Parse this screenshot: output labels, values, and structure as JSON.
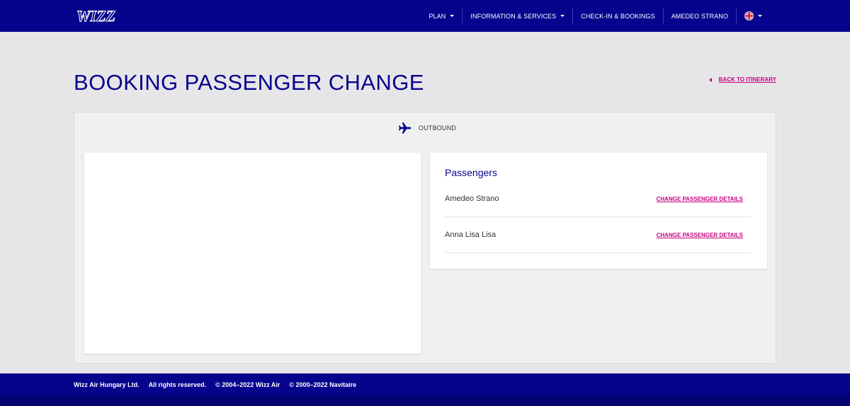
{
  "header": {
    "logo_text": "WIZZ",
    "nav": [
      {
        "label": "PLAN",
        "dropdown": true
      },
      {
        "label": "INFORMATION & SERVICES",
        "dropdown": true
      },
      {
        "label": "CHECK-IN & BOOKINGS",
        "dropdown": false
      },
      {
        "label": "AMEDEO STRANO",
        "dropdown": false
      }
    ],
    "language_icon": "uk-flag-icon"
  },
  "page": {
    "title": "BOOKING PASSENGER CHANGE",
    "back_link": "BACK TO ITINERARY"
  },
  "flight": {
    "direction_icon": "airplane-icon",
    "direction_label": "OUTBOUND"
  },
  "passengers": {
    "heading": "Passengers",
    "list": [
      {
        "name": "Amedeo Strano",
        "action": "CHANGE PASSENGER DETAILS"
      },
      {
        "name": "Anna Lisa Lisa",
        "action": "CHANGE PASSENGER DETAILS"
      }
    ]
  },
  "footer": {
    "company": "Wizz Air Hungary Ltd.",
    "rights": "All rights reserved.",
    "copyright_wizz": "© 2004–2022 Wizz Air",
    "copyright_navitaire": "© 2000–2022 Navitaire"
  },
  "colors": {
    "brand_blue": "#06038d",
    "accent_magenta": "#c6007e"
  }
}
